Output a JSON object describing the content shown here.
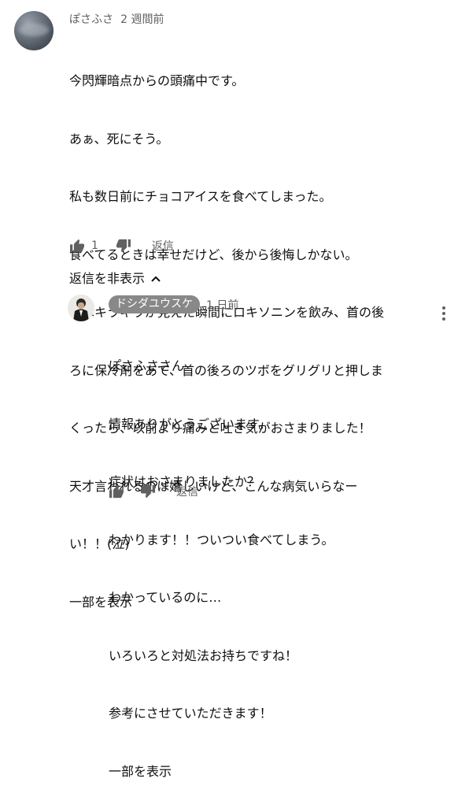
{
  "comment": {
    "author": "ぽさふさ",
    "time": "2 週間前",
    "lines": [
      "今閃輝暗点からの頭痛中です。",
      "あぁ、死にそう。",
      "私も数日前にチョコアイスを食べてしまった。",
      "食べてるときは幸せだけど、後から後悔しかない。",
      "私はキラキラが見えた瞬間にロキソニンを飲み、首の後",
      "ろに保冷剤をあて、首の後ろのツボをグリグリと押しま",
      "くったら、以前より痛みと吐き気がおさまりました！",
      "天才言われるのは嬉しいけど、こんな病気いらなー",
      "い！！(泣)"
    ],
    "show_more": "一部を表示",
    "like_count": "1",
    "reply_label": "返信",
    "hide_replies": "返信を非表示"
  },
  "reply": {
    "author": "ドシダユウスケ",
    "time": "1 日前",
    "lines": [
      "ぽさふささん",
      "情報ありがとうございます。",
      "症状はおさまりましたか？",
      "わかります！！ついつい食べてしまう。",
      "わかっているのに…",
      "いろいろと対処法お持ちですね！",
      "参考にさせていただきます！"
    ],
    "show_more": "一部を表示",
    "reply_label": "返信"
  }
}
